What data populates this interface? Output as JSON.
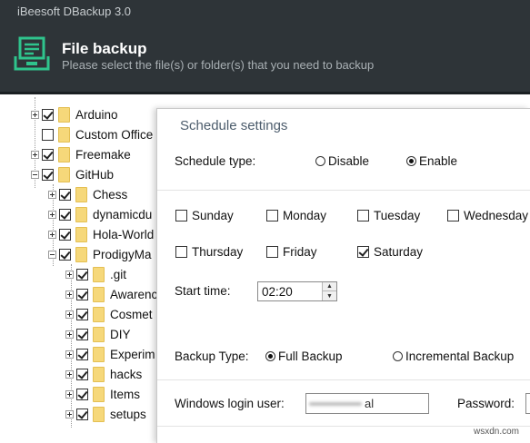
{
  "app": {
    "title": "iBeesoft DBackup 3.0"
  },
  "header": {
    "icon": "file-backup-icon",
    "title": "File backup",
    "subtitle": "Please select the file(s) or folder(s) that you need to backup"
  },
  "tree": {
    "items": [
      {
        "label": "Arduino",
        "checked": true
      },
      {
        "label": "Custom Office",
        "checked": false
      },
      {
        "label": "Freemake",
        "checked": true
      },
      {
        "label": "GitHub",
        "checked": true
      },
      {
        "label": "Chess",
        "checked": true
      },
      {
        "label": "dynamicdu",
        "checked": true
      },
      {
        "label": "Hola-World",
        "checked": true
      },
      {
        "label": "ProdigyMa",
        "checked": true
      },
      {
        "label": ".git",
        "checked": true
      },
      {
        "label": "Awarenc",
        "checked": true
      },
      {
        "label": "Cosmet",
        "checked": true
      },
      {
        "label": "DIY",
        "checked": true
      },
      {
        "label": "Experim",
        "checked": true
      },
      {
        "label": "hacks",
        "checked": true
      },
      {
        "label": "Items",
        "checked": true
      },
      {
        "label": "setups",
        "checked": true
      }
    ]
  },
  "schedule": {
    "title": "Schedule settings",
    "type_label": "Schedule type:",
    "type_options": [
      {
        "label": "Disable",
        "selected": false
      },
      {
        "label": "Enable",
        "selected": true
      }
    ],
    "days": [
      {
        "label": "Sunday",
        "checked": false
      },
      {
        "label": "Monday",
        "checked": false
      },
      {
        "label": "Tuesday",
        "checked": false
      },
      {
        "label": "Wednesday",
        "checked": false
      },
      {
        "label": "Thursday",
        "checked": false
      },
      {
        "label": "Friday",
        "checked": false
      },
      {
        "label": "Saturday",
        "checked": true
      }
    ],
    "start_time_label": "Start time:",
    "start_time": "02:20",
    "backup_type_label": "Backup Type:",
    "backup_types": [
      {
        "label": "Full Backup",
        "selected": true
      },
      {
        "label": "Incremental Backup",
        "selected": false
      }
    ],
    "login_label": "Windows login user:",
    "login_value": "al",
    "password_label": "Password:"
  },
  "watermark": "wsxdn.com",
  "colors": {
    "header_bg": "#2e3438",
    "accent_green": "#2fc48d",
    "folder_yellow": "#f6d87a"
  }
}
